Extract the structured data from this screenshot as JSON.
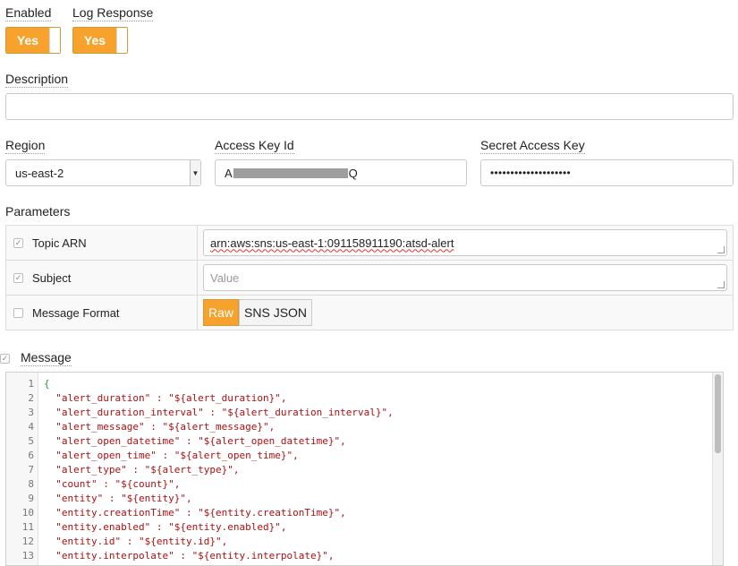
{
  "toggles": {
    "enabled": {
      "label": "Enabled",
      "value": "Yes"
    },
    "log_response": {
      "label": "Log Response",
      "value": "Yes"
    }
  },
  "description": {
    "label": "Description",
    "value": ""
  },
  "region": {
    "label": "Region",
    "value": "us-east-2"
  },
  "access_key": {
    "label": "Access Key Id",
    "prefix": "A",
    "suffix": "Q"
  },
  "secret_key": {
    "label": "Secret Access Key",
    "value": "••••••••••••••••••••"
  },
  "parameters": {
    "label": "Parameters",
    "rows": [
      {
        "name": "Topic ARN",
        "checked": true,
        "value": "arn:aws:sns:us-east-1:091158911190:atsd-alert",
        "placeholder": ""
      },
      {
        "name": "Subject",
        "checked": true,
        "value": "",
        "placeholder": "Value"
      },
      {
        "name": "Message Format",
        "checked": false,
        "options": [
          "Raw",
          "SNS JSON"
        ],
        "selected": "Raw"
      }
    ]
  },
  "message": {
    "label": "Message",
    "checked": true,
    "lines": [
      "{",
      "  \"alert_duration\" : \"${alert_duration}\",",
      "  \"alert_duration_interval\" : \"${alert_duration_interval}\",",
      "  \"alert_message\" : \"${alert_message}\",",
      "  \"alert_open_datetime\" : \"${alert_open_datetime}\",",
      "  \"alert_open_time\" : \"${alert_open_time}\",",
      "  \"alert_type\" : \"${alert_type}\",",
      "  \"count\" : \"${count}\",",
      "  \"entity\" : \"${entity}\",",
      "  \"entity.creationTime\" : \"${entity.creationTime}\",",
      "  \"entity.enabled\" : \"${entity.enabled}\",",
      "  \"entity.id\" : \"${entity.id}\",",
      "  \"entity.interpolate\" : \"${entity.interpolate}\","
    ]
  },
  "colors": {
    "accent": "#f6a22d",
    "code_string": "#aa1111",
    "code_brace": "#2a9a2a"
  }
}
